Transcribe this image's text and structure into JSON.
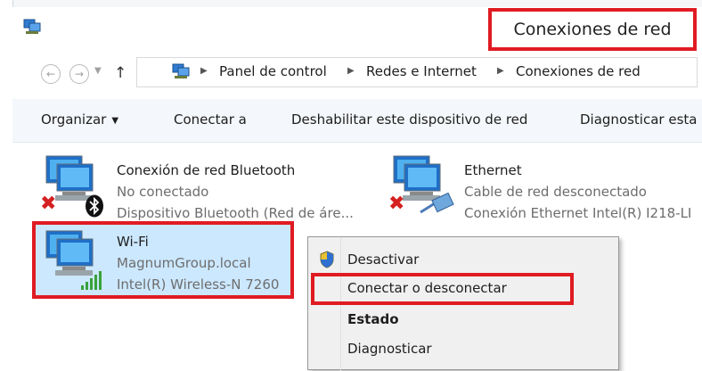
{
  "window": {
    "title": "Conexiones de red"
  },
  "icons": {
    "app": "network-connections-icon",
    "back": "back-arrow-icon",
    "forward": "forward-arrow-icon",
    "recent": "chevron-down-icon",
    "up": "up-arrow-icon",
    "uac": "uac-shield-icon"
  },
  "address": {
    "crumbs": [
      "Panel de control",
      "Redes e Internet",
      "Conexiones de red"
    ]
  },
  "toolbar": {
    "organize": "Organizar",
    "connect_to": "Conectar a",
    "disable": "Deshabilitar este dispositivo de red",
    "diagnose": "Diagnosticar esta"
  },
  "connections": [
    {
      "name": "Conexión de red Bluetooth",
      "status": "No conectado",
      "device": "Dispositivo Bluetooth (Red de áre..."
    },
    {
      "name": "Ethernet",
      "status": "Cable de red desconectado",
      "device": "Conexión Ethernet Intel(R) I218-LI"
    },
    {
      "name": "Wi-Fi",
      "status": "MagnumGroup.local",
      "device": "Intel(R) Wireless-N 7260"
    }
  ],
  "context_menu": {
    "items": [
      {
        "label": "Desactivar"
      },
      {
        "label": "Conectar o desconectar"
      },
      {
        "label": "Estado"
      },
      {
        "label": "Diagnosticar"
      }
    ]
  },
  "colors": {
    "annotation_red": "#e01b22",
    "selection_blue": "#cce8ff",
    "secondary_text": "#6d6d6d",
    "signal_green": "#3aa13a"
  }
}
